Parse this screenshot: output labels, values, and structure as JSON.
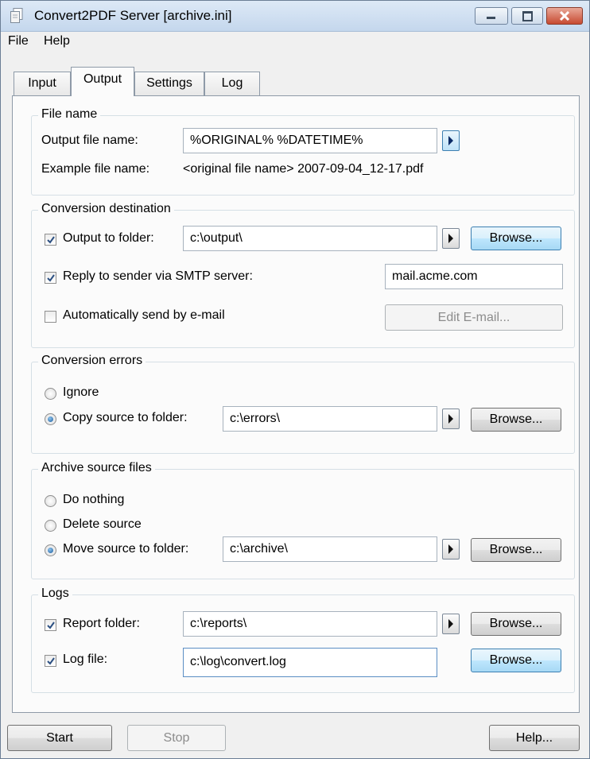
{
  "window": {
    "title": "Convert2PDF Server [archive.ini]"
  },
  "menu": {
    "items": [
      "File",
      "Help"
    ]
  },
  "tabs": [
    "Input",
    "Output",
    "Settings",
    "Log"
  ],
  "active_tab": "Output",
  "file_name": {
    "group_title": "File name",
    "output_label": "Output file name:",
    "output_value": "%ORIGINAL% %DATETIME%",
    "example_label": "Example file name:",
    "example_value": "<original file name> 2007-09-04_12-17.pdf"
  },
  "conversion_destination": {
    "group_title": "Conversion destination",
    "output_to_folder_label": "Output to folder:",
    "output_to_folder_checked": true,
    "output_folder_value": "c:\\output\\",
    "browse_label": "Browse...",
    "reply_smtp_label": "Reply to sender via SMTP server:",
    "reply_smtp_checked": true,
    "smtp_value": "mail.acme.com",
    "auto_email_label": "Automatically send by e-mail",
    "auto_email_checked": false,
    "edit_email_label": "Edit E-mail..."
  },
  "conversion_errors": {
    "group_title": "Conversion errors",
    "ignore_label": "Ignore",
    "copy_label": "Copy source to folder:",
    "selected": "copy",
    "errors_folder_value": "c:\\errors\\",
    "browse_label": "Browse..."
  },
  "archive": {
    "group_title": "Archive source files",
    "do_nothing_label": "Do nothing",
    "delete_label": "Delete source",
    "move_label": "Move source to folder:",
    "selected": "move",
    "archive_folder_value": "c:\\archive\\",
    "browse_label": "Browse..."
  },
  "logs": {
    "group_title": "Logs",
    "report_folder_label": "Report folder:",
    "report_folder_checked": true,
    "report_folder_value": "c:\\reports\\",
    "log_file_label": "Log file:",
    "log_file_checked": true,
    "log_file_value": "c:\\log\\convert.log",
    "browse_label": "Browse..."
  },
  "footer": {
    "start_label": "Start",
    "stop_label": "Stop",
    "help_label": "Help..."
  }
}
